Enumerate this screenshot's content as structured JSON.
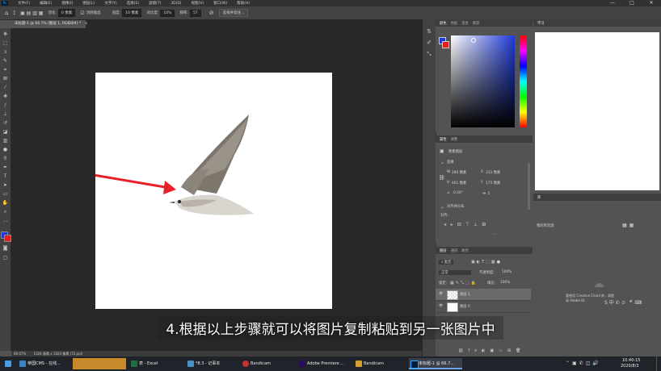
{
  "menubar": {
    "items": [
      "文件(F)",
      "编辑(E)",
      "图像(I)",
      "图层(L)",
      "文字(Y)",
      "选择(S)",
      "滤镜(T)",
      "3D(D)",
      "视图(V)",
      "窗口(W)",
      "帮助(H)"
    ],
    "window_controls": [
      "—",
      "□",
      "✕"
    ]
  },
  "options_bar": {
    "feather_label": "羽化:",
    "feather_value": "0 像素",
    "antialias_label": "消除锯齿",
    "style_label": "样式:",
    "style_value": "正常",
    "width_label": "宽度:",
    "width_value": "10 像素",
    "contrast_label": "对比度:",
    "contrast_value": "10%",
    "frequency_label": "频率:",
    "frequency_value": "57",
    "select_mask_button": "选择并遮住..."
  },
  "document_tab": {
    "title": "未标题-1 @ 66.7% (图层 1, RGB/8#) *",
    "close": "×"
  },
  "status_bar": {
    "zoom": "66.67%",
    "doc_size": "1024 像素 x 1024 像素 (72 ppi)"
  },
  "color_panel": {
    "tabs": [
      "颜色",
      "色板",
      "渐变",
      "图案"
    ],
    "fg_color": "#1f3bd6",
    "bg_color": "#e02020"
  },
  "properties_panel": {
    "tabs": [
      "属性",
      "调整"
    ],
    "layer_kind": "像素图层",
    "transform_title": "变换",
    "w_label": "W",
    "w_value": "280 像素",
    "x_label": "X",
    "x_value": "333 像素",
    "h_label": "H",
    "h_value": "461 像素",
    "y_label": "Y",
    "y_value": "175 像素",
    "angle_value": "0.00°",
    "align_title": "对齐并分布",
    "align_label": "对齐:",
    "more": "..."
  },
  "layers_panel": {
    "tabs": [
      "图层",
      "通道",
      "路径"
    ],
    "kind_label": "类型",
    "blend_mode": "正常",
    "opacity_label": "不透明度:",
    "opacity_value": "100%",
    "lock_label": "锁定:",
    "fill_label": "填充:",
    "fill_value": "100%",
    "layers": [
      {
        "name": "图层 1",
        "visible": "👁",
        "active": true
      },
      {
        "name": "图层 0",
        "visible": "👁",
        "active": false
      }
    ]
  },
  "learn_panel": {
    "tabs": [
      "学习"
    ]
  },
  "libraries_panel": {
    "tabs": [
      "库"
    ],
    "dropdown": "我的库资源",
    "login_text": "要使用 Creative Cloud 库，请登录 Adobe ID"
  },
  "subtitle": "4.根据以上步骤就可以将图片复制粘贴到另一张图片中",
  "taskbar": {
    "items": [
      {
        "label": "帝国CMS - 在线...",
        "color": "#3b82c4"
      },
      {
        "label": "",
        "color": "#c8892a"
      },
      {
        "label": "表 - Excel",
        "color": "#1d6f42"
      },
      {
        "label": "*8.3 - 记事本",
        "color": "#4a90c0"
      },
      {
        "label": "Bandicam",
        "color": "#c83030"
      },
      {
        "label": "Adobe Premiere ...",
        "color": "#2a0a5a"
      },
      {
        "label": "Bandicam",
        "color": "#d4a030"
      },
      {
        "label": "未标题-1 @ 66.7...",
        "color": "#001e36"
      }
    ],
    "time": "10:40:15",
    "date": "2020/8/3"
  }
}
